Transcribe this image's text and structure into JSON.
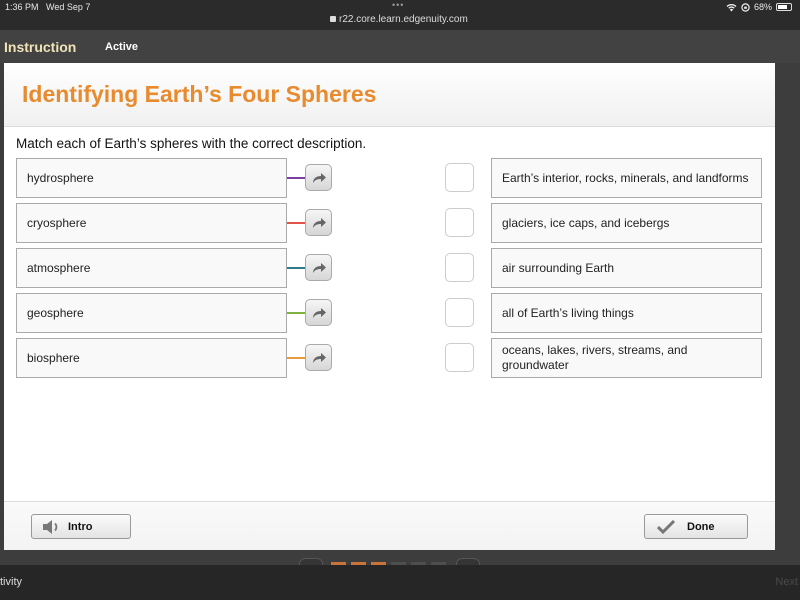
{
  "status_bar": {
    "time": "1:36 PM",
    "date": "Wed Sep 7",
    "url": "r22.core.learn.edgenuity.com",
    "battery_percent": "68%",
    "battery_level": 0.68
  },
  "topbar": {
    "section": "Instruction",
    "state": "Active"
  },
  "activity": {
    "title": "Identifying Earth’s Four Spheres",
    "prompt": "Match each of Earth’s spheres with the correct description.",
    "terms": [
      {
        "label": "hydrosphere",
        "color": "#7b3fa0"
      },
      {
        "label": "cryosphere",
        "color": "#e0524a"
      },
      {
        "label": "atmosphere",
        "color": "#2f7a8a"
      },
      {
        "label": "geosphere",
        "color": "#7fb241"
      },
      {
        "label": "biosphere",
        "color": "#e99a3c"
      }
    ],
    "descriptions": [
      {
        "label": "Earth’s interior, rocks, minerals, and landforms"
      },
      {
        "label": "glaciers, ice caps, and icebergs"
      },
      {
        "label": "air surrounding Earth"
      },
      {
        "label": "all of Earth’s living things"
      },
      {
        "label": "oceans, lakes, rivers, streams, and groundwater"
      }
    ]
  },
  "footer": {
    "intro_label": "Intro",
    "done_label": "Done"
  },
  "pager": {
    "completed_color": "#c8743a",
    "remaining_color": "#4e4e4e",
    "pages_completed": 3,
    "pages_total": 6
  },
  "bottombar": {
    "activity_label": "tivity",
    "next_label": "Next"
  }
}
